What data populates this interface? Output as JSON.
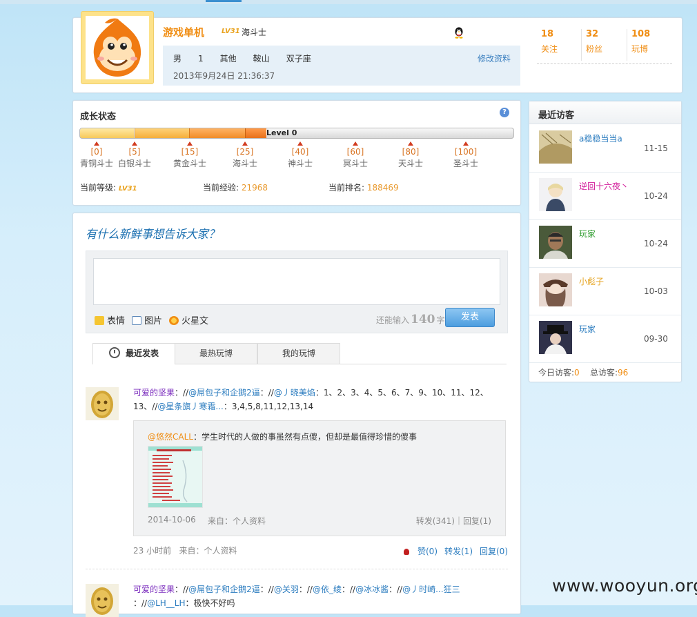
{
  "profile": {
    "name": "游戏单机",
    "level_badge": "LV31",
    "rank": "海斗士",
    "gender": "男",
    "age": "1",
    "field3": "其他",
    "city": "鞍山",
    "zodiac": "双子座",
    "joined": "2013年9月24日 21:36:37",
    "edit_label": "修改资料",
    "stats": [
      {
        "value": "18",
        "label": "关注"
      },
      {
        "value": "32",
        "label": "粉丝"
      },
      {
        "value": "108",
        "label": "玩博"
      }
    ]
  },
  "growth": {
    "title": "成长状态",
    "help": "?",
    "bar_label": "Level 0",
    "marks": [
      {
        "value": "[0]",
        "title": "青铜斗士"
      },
      {
        "value": "[5]",
        "title": "白银斗士"
      },
      {
        "value": "[15]",
        "title": "黄金斗士"
      },
      {
        "value": "[25]",
        "title": "海斗士"
      },
      {
        "value": "[40]",
        "title": "神斗士"
      },
      {
        "value": "[60]",
        "title": "冥斗士"
      },
      {
        "value": "[80]",
        "title": "天斗士"
      },
      {
        "value": "[100]",
        "title": "圣斗士"
      }
    ],
    "level_label": "当前等级:",
    "level_value": "LV31",
    "exp_label": "当前经验:",
    "exp_value": "21968",
    "rank_label": "当前排名:",
    "rank_value": "188469"
  },
  "composer": {
    "slogan": "有什么新鲜事想告诉大家？",
    "tools": [
      "表情",
      "图片",
      "火星文"
    ],
    "remain_prefix": "还能输入",
    "remain_count": "140",
    "remain_suffix": "字",
    "send_label": "发表"
  },
  "tabs": [
    "最近发表",
    "最热玩博",
    "我的玩博"
  ],
  "posts": [
    {
      "author": "可爱的坚果",
      "sep1": "：//",
      "m1": "@屌包子和企鹅2逼",
      "sep2": "：//",
      "m2": "@丿晓美焰",
      "body1": "：1、2、3、4、5、6、7、9、10、11、12、",
      "body2": "13、//",
      "m3": "@星条旗丿寒霜...",
      "body3": "：3,4,5,8,11,12,13,14",
      "quote_author": "@悠然CALL",
      "quote_text": "：学生时代的人做的事虽然有点傻，但却是最值得珍惜的傻事",
      "quote_date": "2014-10-06",
      "quote_source": "来自：个人资料",
      "quote_actions": "转发(341)｜回复(1)",
      "time": "23 小时前",
      "source": "来自：个人资料",
      "like": "赞(0)",
      "forward": "转发(1)",
      "reply": "回复(0)"
    },
    {
      "author": "可爱的坚果",
      "sep1": "：//",
      "m1": "@屌包子和企鹅2逼",
      "sep2": "：//",
      "m2": "@关羽",
      "sep3": "：//",
      "m3": "@依_绫",
      "sep4": "：//",
      "m4": "@冰冰酱",
      "sep5": "：//",
      "m5": "@丿时崎...狂三",
      "sep6": "：//",
      "m6": "@LH__LH",
      "body": "：极快不好吗"
    }
  ],
  "visitors": {
    "title": "最近访客",
    "items": [
      {
        "name": "a稳稳当当a",
        "date": "11-15",
        "color": "#2b7cbf"
      },
      {
        "name": "逆回十六夜丶",
        "date": "10-24",
        "color": "#d21c9a"
      },
      {
        "name": "玩家",
        "date": "10-24",
        "color": "#2a9a2a"
      },
      {
        "name": "小彪子",
        "date": "10-03",
        "color": "#e5a21c"
      },
      {
        "name": "玩家",
        "date": "09-30",
        "color": "#2b7cbf"
      }
    ],
    "today_label": "今日访客:",
    "today": "0",
    "total_label": "总访客:",
    "total": "96"
  },
  "watermark": "www.wooyun.org"
}
